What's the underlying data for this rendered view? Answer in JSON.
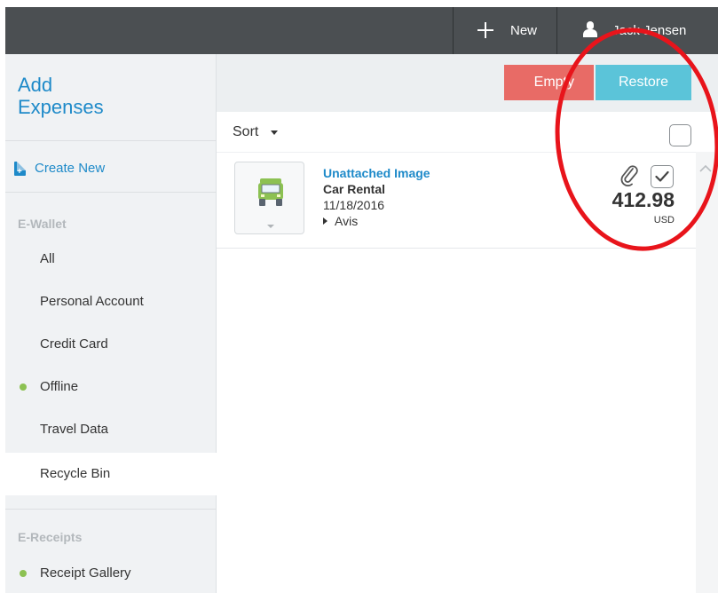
{
  "topbar": {
    "new_label": "New",
    "user_name": "Jack Jensen"
  },
  "sidebar": {
    "title_line1": "Add",
    "title_line2": "Expenses",
    "create_new": "Create New",
    "ewallet_heading": "E-Wallet",
    "items": [
      {
        "label": "All"
      },
      {
        "label": "Personal Account"
      },
      {
        "label": "Credit Card"
      },
      {
        "label": "Offline"
      },
      {
        "label": "Travel Data"
      },
      {
        "label": "Recycle Bin"
      }
    ],
    "ereceipts_heading": "E-Receipts",
    "receipt_gallery": "Receipt Gallery"
  },
  "actions": {
    "empty_label": "Empty",
    "restore_label": "Restore"
  },
  "sortbar": {
    "sort_label": "Sort"
  },
  "expense": {
    "image_status": "Unattached Image",
    "type": "Car Rental",
    "date": "11/18/2016",
    "vendor": "Avis",
    "amount": "412.98",
    "currency": "USD"
  },
  "colors": {
    "topbar": "#4b4f52",
    "accent": "#1e8ac9",
    "empty_button": "#e86b66",
    "restore_button": "#5bc4d9",
    "status_dot": "#8cc152",
    "annotation": "#e8141b"
  },
  "icons": [
    "plus-icon",
    "user-icon",
    "add-document-icon",
    "car-icon",
    "paperclip-icon",
    "checkmark-icon",
    "chevron-up-icon",
    "caret-down-icon",
    "caret-right-icon"
  ]
}
